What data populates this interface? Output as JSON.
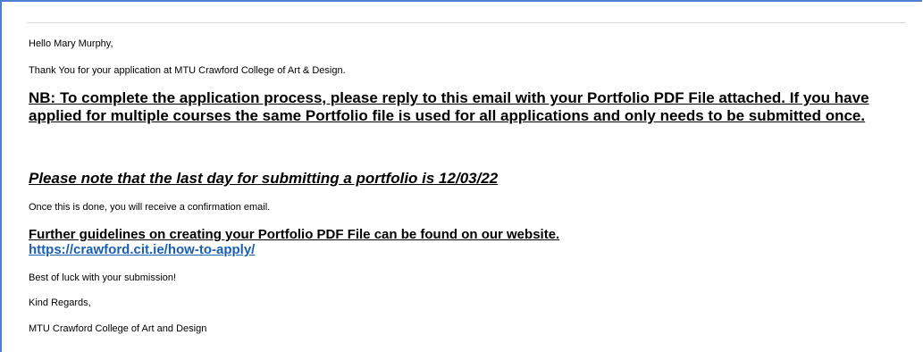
{
  "email": {
    "greeting": "Hello Mary Murphy,",
    "thanks": "Thank You for your application at MTU Crawford College of Art & Design.",
    "nb_notice": "NB: To complete the application process, please reply to this email with your Portfolio PDF File attached. If you have applied for multiple courses the same Portfolio file is used for all applications and only needs to be submitted once.",
    "deadline_notice": "Please note that the last day for submitting a portfolio is 12/03/22",
    "confirmation": "Once this is done, you will receive a confirmation email.",
    "guidelines": "Further guidelines on creating your Portfolio PDF File can be found on our website.",
    "website_link": "https://crawford.cit.ie/how-to-apply/",
    "good_luck": "Best of luck with your submission!",
    "sign_off": "Kind Regards,",
    "signature": "MTU Crawford College of Art and Design"
  },
  "colors": {
    "frame_border": "#4a7fd4",
    "link": "#1a5fb4",
    "text": "#000000"
  }
}
